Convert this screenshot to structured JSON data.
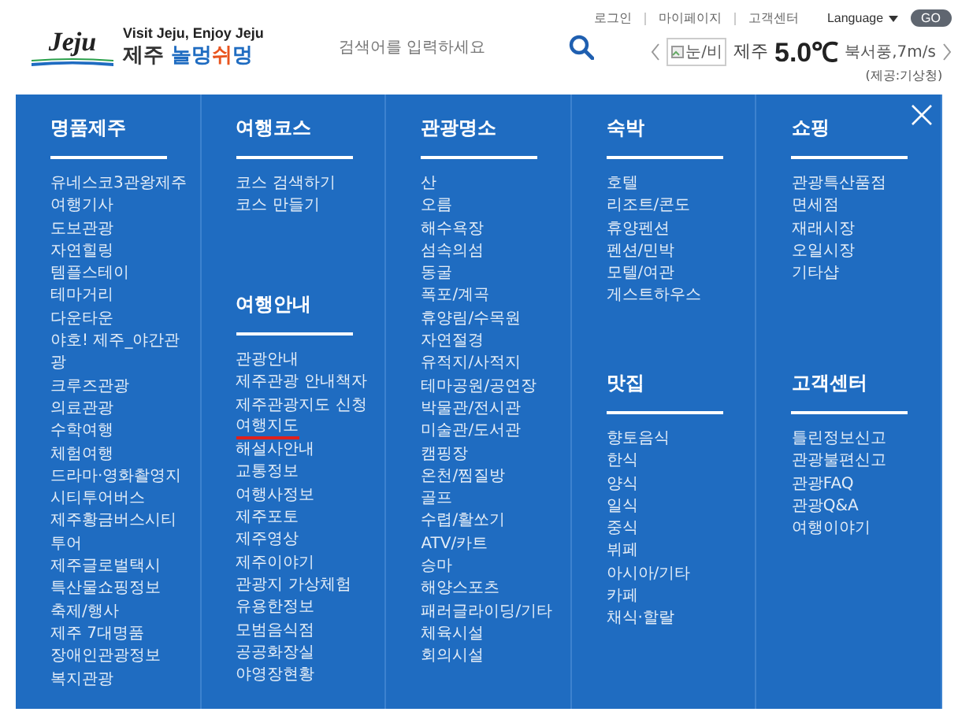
{
  "header": {
    "logo": {
      "mark": "Jeju",
      "tagline": "Visit Jeju, Enjoy Jeju",
      "slogan": [
        {
          "text": "제주 ",
          "color": "#333333"
        },
        {
          "text": "놀멍",
          "color": "#1f6cc1"
        },
        {
          "text": "쉬",
          "color": "#e8541e"
        },
        {
          "text": "멍",
          "color": "#1f6cc1"
        }
      ]
    },
    "search": {
      "placeholder": "검색어를 입력하세요"
    },
    "links": [
      "로그인",
      "마이페이지",
      "고객센터"
    ],
    "language": {
      "label": "Language",
      "button": "GO"
    },
    "weather": {
      "image_alt": "눈/비",
      "place": "제주",
      "temperature": "5.0℃",
      "wind": "북서풍,7m/s",
      "source": "(제공:기상청)"
    }
  },
  "menu": {
    "columns": [
      {
        "sections": [
          {
            "title": "명품제주",
            "items": [
              {
                "label": "유네스코3관왕제주",
                "underlined": false
              },
              {
                "label": "여행기사",
                "underlined": false
              },
              {
                "label": "도보관광",
                "underlined": false
              },
              {
                "label": "자연힐링",
                "underlined": false
              },
              {
                "label": "템플스테이",
                "underlined": false
              },
              {
                "label": "테마거리",
                "underlined": false
              },
              {
                "label": "다운타운",
                "underlined": false
              },
              {
                "label": "야호! 제주_야간관광",
                "underlined": false
              },
              {
                "label": "크루즈관광",
                "underlined": false
              },
              {
                "label": "의료관광",
                "underlined": false
              },
              {
                "label": "수학여행",
                "underlined": false
              },
              {
                "label": "체험여행",
                "underlined": false
              },
              {
                "label": "드라마·영화촬영지",
                "underlined": false
              },
              {
                "label": "시티투어버스",
                "underlined": false
              },
              {
                "label": "제주황금버스시티투어",
                "underlined": false
              },
              {
                "label": "제주글로벌택시",
                "underlined": false
              },
              {
                "label": "특산물쇼핑정보",
                "underlined": false
              },
              {
                "label": "축제/행사",
                "underlined": false
              },
              {
                "label": "제주 7대명품",
                "underlined": false
              },
              {
                "label": "장애인관광정보",
                "underlined": false
              },
              {
                "label": "복지관광",
                "underlined": false
              }
            ]
          }
        ]
      },
      {
        "sections": [
          {
            "title": "여행코스",
            "items": [
              {
                "label": "코스 검색하기",
                "underlined": false
              },
              {
                "label": "코스 만들기",
                "underlined": false
              }
            ]
          },
          {
            "title": "여행안내",
            "items": [
              {
                "label": "관광안내",
                "underlined": false
              },
              {
                "label": "제주관광 안내책자",
                "underlined": false
              },
              {
                "label": "제주관광지도 신청",
                "underlined": false
              },
              {
                "label": "여행지도",
                "underlined": true
              },
              {
                "label": "해설사안내",
                "underlined": false
              },
              {
                "label": "교통정보",
                "underlined": false
              },
              {
                "label": "여행사정보",
                "underlined": false
              },
              {
                "label": "제주포토",
                "underlined": false
              },
              {
                "label": "제주영상",
                "underlined": false
              },
              {
                "label": "제주이야기",
                "underlined": false
              },
              {
                "label": "관광지 가상체험",
                "underlined": false
              },
              {
                "label": "유용한정보",
                "underlined": false
              },
              {
                "label": "모범음식점",
                "underlined": false
              },
              {
                "label": "공공화장실",
                "underlined": false
              },
              {
                "label": "야영장현황",
                "underlined": false
              }
            ]
          }
        ]
      },
      {
        "sections": [
          {
            "title": "관광명소",
            "items": [
              {
                "label": "산",
                "underlined": false
              },
              {
                "label": "오름",
                "underlined": false
              },
              {
                "label": "해수욕장",
                "underlined": false
              },
              {
                "label": "섬속의섬",
                "underlined": false
              },
              {
                "label": "동굴",
                "underlined": false
              },
              {
                "label": "폭포/계곡",
                "underlined": false
              },
              {
                "label": "휴양림/수목원",
                "underlined": false
              },
              {
                "label": "자연절경",
                "underlined": false
              },
              {
                "label": "유적지/사적지",
                "underlined": false
              },
              {
                "label": "테마공원/공연장",
                "underlined": false
              },
              {
                "label": "박물관/전시관",
                "underlined": false
              },
              {
                "label": "미술관/도서관",
                "underlined": false
              },
              {
                "label": "캠핑장",
                "underlined": false
              },
              {
                "label": "온천/찜질방",
                "underlined": false
              },
              {
                "label": "골프",
                "underlined": false
              },
              {
                "label": "수렵/활쏘기",
                "underlined": false
              },
              {
                "label": "ATV/카트",
                "underlined": false
              },
              {
                "label": "승마",
                "underlined": false
              },
              {
                "label": "해양스포츠",
                "underlined": false
              },
              {
                "label": "패러글라이딩/기타",
                "underlined": false
              },
              {
                "label": "체육시설",
                "underlined": false
              },
              {
                "label": "회의시설",
                "underlined": false
              }
            ]
          }
        ]
      },
      {
        "sections": [
          {
            "title": "숙박",
            "items": [
              {
                "label": "호텔",
                "underlined": false
              },
              {
                "label": "리조트/콘도",
                "underlined": false
              },
              {
                "label": "휴양펜션",
                "underlined": false
              },
              {
                "label": "펜션/민박",
                "underlined": false
              },
              {
                "label": "모텔/여관",
                "underlined": false
              },
              {
                "label": "게스트하우스",
                "underlined": false
              }
            ]
          },
          {
            "title": "맛집",
            "items": [
              {
                "label": "향토음식",
                "underlined": false
              },
              {
                "label": "한식",
                "underlined": false
              },
              {
                "label": "양식",
                "underlined": false
              },
              {
                "label": "일식",
                "underlined": false
              },
              {
                "label": "중식",
                "underlined": false
              },
              {
                "label": "뷔페",
                "underlined": false
              },
              {
                "label": "아시아/기타",
                "underlined": false
              },
              {
                "label": "카페",
                "underlined": false
              },
              {
                "label": "채식·할랄",
                "underlined": false
              }
            ]
          }
        ]
      },
      {
        "sections": [
          {
            "title": "쇼핑",
            "items": [
              {
                "label": "관광특산품점",
                "underlined": false
              },
              {
                "label": "면세점",
                "underlined": false
              },
              {
                "label": "재래시장",
                "underlined": false
              },
              {
                "label": "오일시장",
                "underlined": false
              },
              {
                "label": "기타샵",
                "underlined": false
              }
            ]
          },
          {
            "title": "고객센터",
            "items": [
              {
                "label": "틀린정보신고",
                "underlined": false
              },
              {
                "label": "관광불편신고",
                "underlined": false
              },
              {
                "label": "관광FAQ",
                "underlined": false
              },
              {
                "label": "관광Q&A",
                "underlined": false
              },
              {
                "label": "여행이야기",
                "underlined": false
              }
            ]
          }
        ]
      }
    ]
  }
}
